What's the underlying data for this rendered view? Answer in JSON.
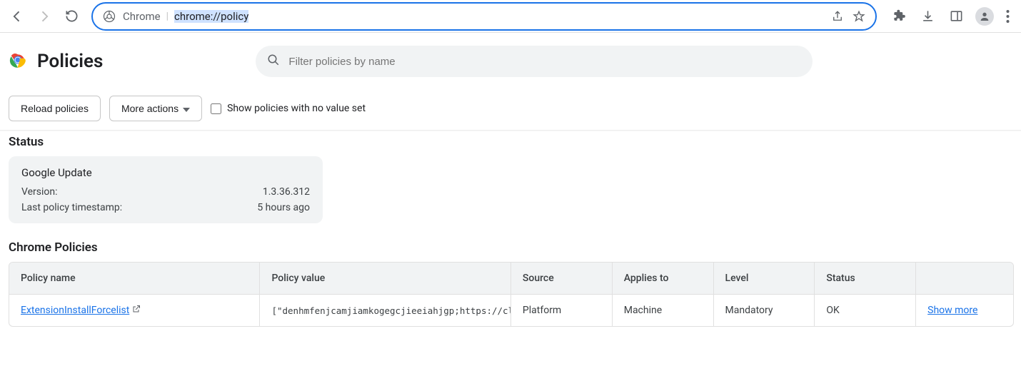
{
  "browser": {
    "site_label": "Chrome",
    "url": "chrome://policy"
  },
  "page": {
    "title": "Policies",
    "search_placeholder": "Filter policies by name"
  },
  "actions": {
    "reload_label": "Reload policies",
    "more_label": "More actions",
    "show_empty_label": "Show policies with no value set",
    "show_empty_checked": false
  },
  "status": {
    "section_title": "Status",
    "card_title": "Google Update",
    "rows": [
      {
        "label": "Version:",
        "value": "1.3.36.312"
      },
      {
        "label": "Last policy timestamp:",
        "value": "5 hours ago"
      }
    ]
  },
  "chrome_policies": {
    "section_title": "Chrome Policies",
    "headers": {
      "name": "Policy name",
      "value": "Policy value",
      "source": "Source",
      "applies": "Applies to",
      "level": "Level",
      "status": "Status"
    },
    "rows": [
      {
        "name": "ExtensionInstallForcelist",
        "value": "[\"denhmfenjcamjiamkogegcjieeiahjgp;https://cl…",
        "source": "Platform",
        "applies": "Machine",
        "level": "Mandatory",
        "status": "OK",
        "action": "Show more"
      }
    ]
  },
  "next_section_title_partial": ""
}
